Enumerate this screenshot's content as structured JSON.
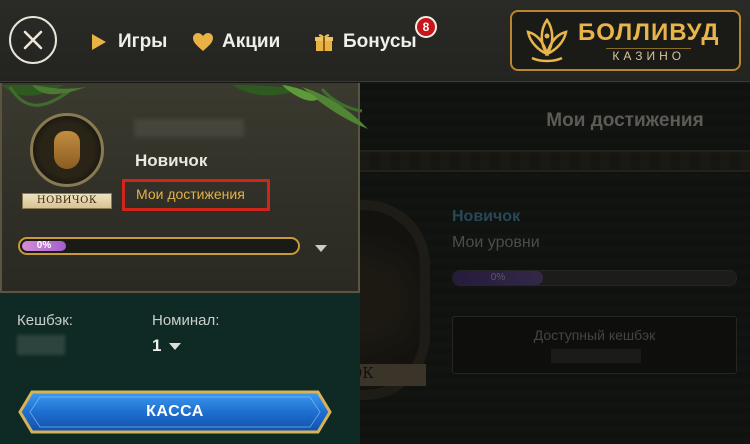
{
  "nav": {
    "items": [
      {
        "label": "Игры",
        "icon": "play-icon"
      },
      {
        "label": "Акции",
        "icon": "heart-icon"
      },
      {
        "label": "Бонусы",
        "icon": "gift-icon"
      }
    ],
    "bonus_badge": "8",
    "close_icon": "close-icon"
  },
  "logo": {
    "main": "БОЛЛИВУД",
    "sub": "КАЗИНО"
  },
  "profile": {
    "avatar_plate": "НОВИЧОК",
    "rank": "Новичок",
    "achievements_link": "Мои достижения",
    "progress_label": "0%",
    "progress": 0
  },
  "wallet": {
    "cashback_label": "Кешбэк:",
    "nominal_label": "Номинал:",
    "nominal_value": "1",
    "cashier_button": "КАССА"
  },
  "background": {
    "title": "Мои достижения",
    "level": "Новичок",
    "levels_link": "Мои уровни",
    "progress_label": "0%",
    "cashback_title": "Доступный кешбэк",
    "avatar_plate_fragment": "ОК"
  },
  "colors": {
    "accent_gold": "#c89a3a",
    "highlight_red": "#d1251c",
    "button_blue": "#1d6fd0",
    "panel_bg": "#0f2a24"
  }
}
